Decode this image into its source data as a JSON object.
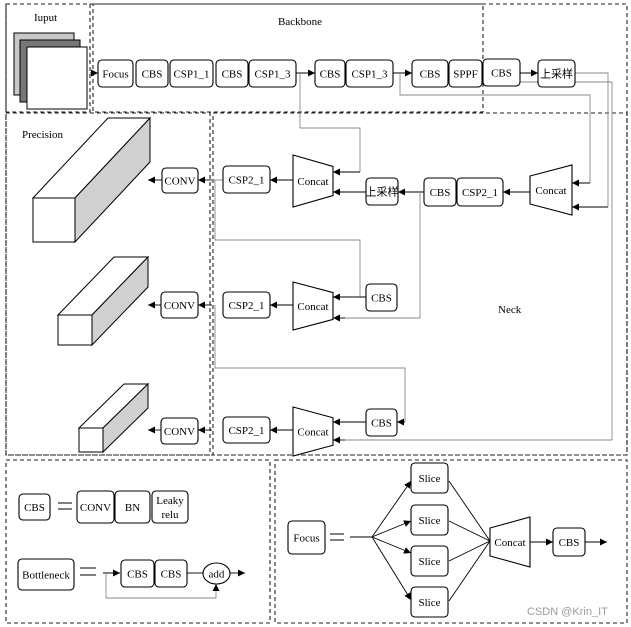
{
  "sections": {
    "input": "Iuput",
    "backbone": "Backbone",
    "precision": "Precision",
    "neck": "Neck"
  },
  "backbone": {
    "blocks": [
      "Focus",
      "CBS",
      "CSP1_1",
      "CBS",
      "CSP1_3",
      "CBS",
      "CSP1_3",
      "CBS",
      "SPPF",
      "CBS",
      "上采样"
    ]
  },
  "neck": {
    "row1": [
      "CONV",
      "CSP2_1",
      "Concat",
      "上采样",
      "CBS",
      "CSP2_1",
      "Concat"
    ],
    "row2": [
      "CONV",
      "CSP2_1",
      "Concat",
      "CBS"
    ],
    "row3": [
      "CONV",
      "CSP2_1",
      "Concat",
      "CBS"
    ]
  },
  "legend_cbs": {
    "name": "CBS",
    "parts": [
      "CONV",
      "BN",
      "Leaky",
      "relu"
    ]
  },
  "legend_bottleneck": {
    "name": "Bottleneck",
    "parts": [
      "CBS",
      "CBS",
      "add"
    ]
  },
  "legend_focus": {
    "name": "Focus",
    "slices": [
      "Slice",
      "Slice",
      "Slice",
      "Slice"
    ],
    "concat": "Concat",
    "cbs": "CBS"
  },
  "watermark": "CSDN @Krin_IT"
}
